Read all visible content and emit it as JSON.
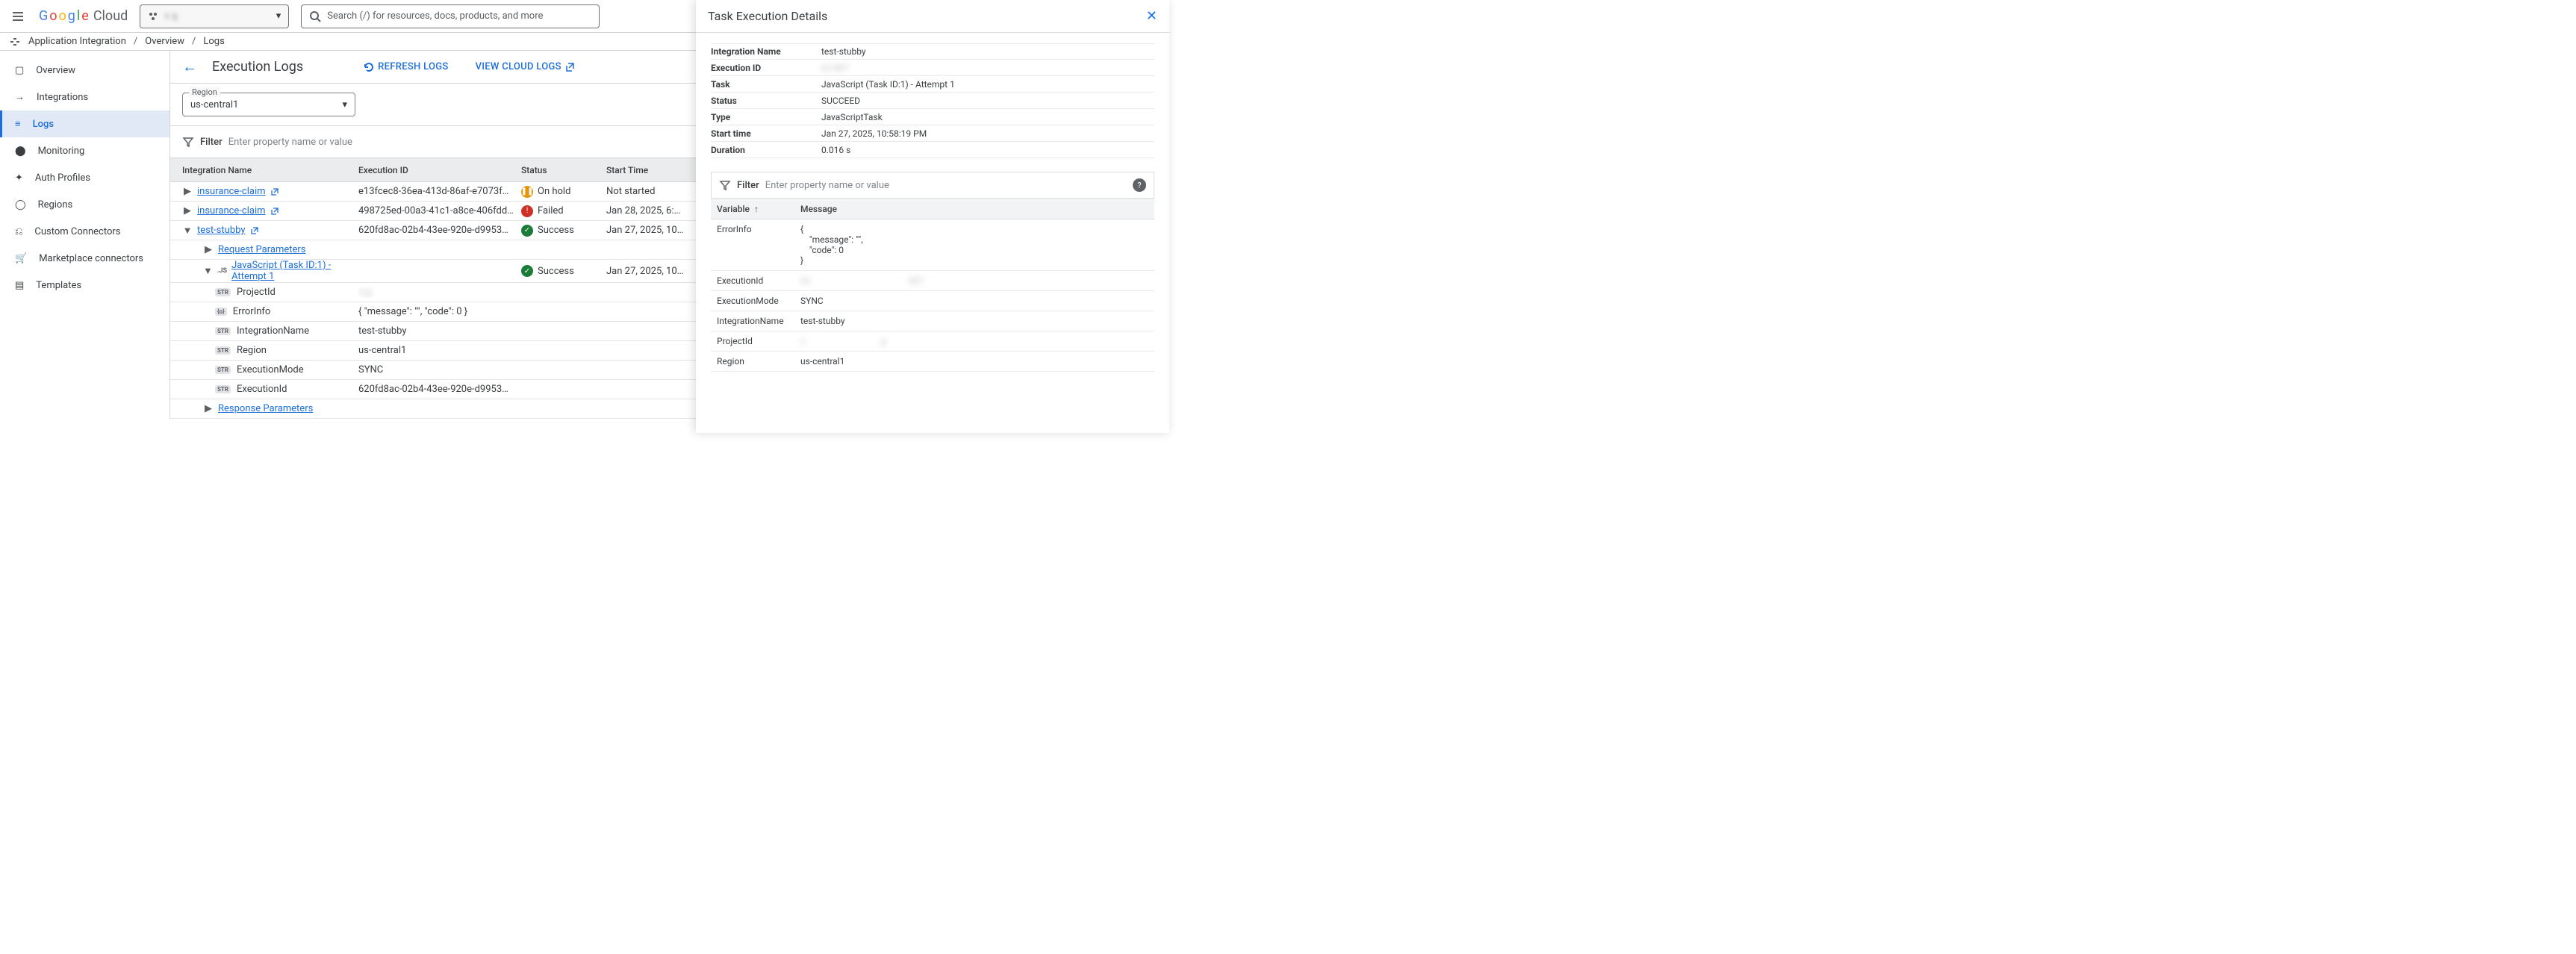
{
  "header": {
    "logo_text": "Google",
    "logo_suffix": "Cloud",
    "project_selector_value": "s                               g",
    "search_placeholder": "Search (/) for resources, docs, products, and more"
  },
  "breadcrumbs": {
    "product": "Application Integration",
    "l1": "Overview",
    "l2": "Logs"
  },
  "sidebar": {
    "items": [
      {
        "label": "Overview"
      },
      {
        "label": "Integrations"
      },
      {
        "label": "Logs"
      },
      {
        "label": "Monitoring"
      },
      {
        "label": "Auth Profiles"
      },
      {
        "label": "Regions"
      },
      {
        "label": "Custom Connectors"
      },
      {
        "label": "Marketplace connectors"
      },
      {
        "label": "Templates"
      }
    ],
    "active_index": 2
  },
  "page": {
    "title": "Execution Logs",
    "refresh_label": "Refresh Logs",
    "view_cloud_logs_label": "View Cloud Logs",
    "region_label": "Region",
    "region_value": "us-central1",
    "filter_label": "Filter",
    "filter_placeholder": "Enter property name or value"
  },
  "columns": {
    "c0": "Integration Name",
    "c1": "Execution ID",
    "c2": "Status",
    "c3": "Start Time"
  },
  "rows": [
    {
      "kind": "top",
      "name": "insurance-claim",
      "exec": "e13fcec8-36ea-413d-86af-e7073f…",
      "status": "On hold",
      "status_kind": "hold",
      "start": "Not started",
      "expand": "▶"
    },
    {
      "kind": "top",
      "name": "insurance-claim",
      "exec": "498725ed-00a3-41c1-a8ce-406fdd…",
      "status": "Failed",
      "status_kind": "fail",
      "start": "Jan 28, 2025, 6:…",
      "expand": "▶"
    },
    {
      "kind": "top",
      "name": "test-stubby",
      "exec": "620fd8ac-02b4-43ee-920e-d9953…",
      "status": "Success",
      "status_kind": "ok",
      "start": "Jan 27, 2025, 10…",
      "expand": "▼"
    },
    {
      "kind": "req",
      "label": "Request Parameters"
    },
    {
      "kind": "task",
      "label": "JavaScript (Task ID:1) - Attempt 1",
      "status": "Success",
      "status_kind": "ok",
      "start": "Jan 27, 2025, 10…",
      "expand": "▼"
    },
    {
      "kind": "var",
      "pill": "STR",
      "name": "ProjectId",
      "val": "s                                     g",
      "blur": true
    },
    {
      "kind": "var",
      "pill": "{o}",
      "name": "ErrorInfo",
      "val": "{ \"message\": \"\", \"code\": 0 }"
    },
    {
      "kind": "var",
      "pill": "STR",
      "name": "IntegrationName",
      "val": "test-stubby"
    },
    {
      "kind": "var",
      "pill": "STR",
      "name": "Region",
      "val": "us-central1"
    },
    {
      "kind": "var",
      "pill": "STR",
      "name": "ExecutionMode",
      "val": "SYNC"
    },
    {
      "kind": "var",
      "pill": "STR",
      "name": "ExecutionId",
      "val": "620fd8ac-02b4-43ee-920e-d9953…"
    },
    {
      "kind": "resp",
      "label": "Response Parameters"
    }
  ],
  "panel": {
    "title": "Task Execution Details",
    "kv": [
      {
        "k": "Integration Name",
        "v": "test-stubby"
      },
      {
        "k": "Execution ID",
        "v": "62                                             807",
        "blur": true
      },
      {
        "k": "Task",
        "v": "JavaScript (Task ID:1) - Attempt 1"
      },
      {
        "k": "Status",
        "v": "SUCCEED"
      },
      {
        "k": "Type",
        "v": "JavaScriptTask"
      },
      {
        "k": "Start time",
        "v": "Jan 27, 2025, 10:58:19 PM"
      },
      {
        "k": "Duration",
        "v": "0.016 s"
      }
    ],
    "filter_label": "Filter",
    "filter_placeholder": "Enter property name or value",
    "var_col0": "Variable",
    "var_col1": "Message",
    "vars": [
      {
        "k": "ErrorInfo",
        "v": "{\n    \"message\": \"\",\n    \"code\": 0\n}"
      },
      {
        "k": "ExecutionId",
        "v": "62                                            307",
        "blur": true
      },
      {
        "k": "ExecutionMode",
        "v": "SYNC"
      },
      {
        "k": "IntegrationName",
        "v": "test-stubby"
      },
      {
        "k": "ProjectId",
        "v": "s                                  g",
        "blur": true
      },
      {
        "k": "Region",
        "v": "us-central1"
      }
    ]
  }
}
